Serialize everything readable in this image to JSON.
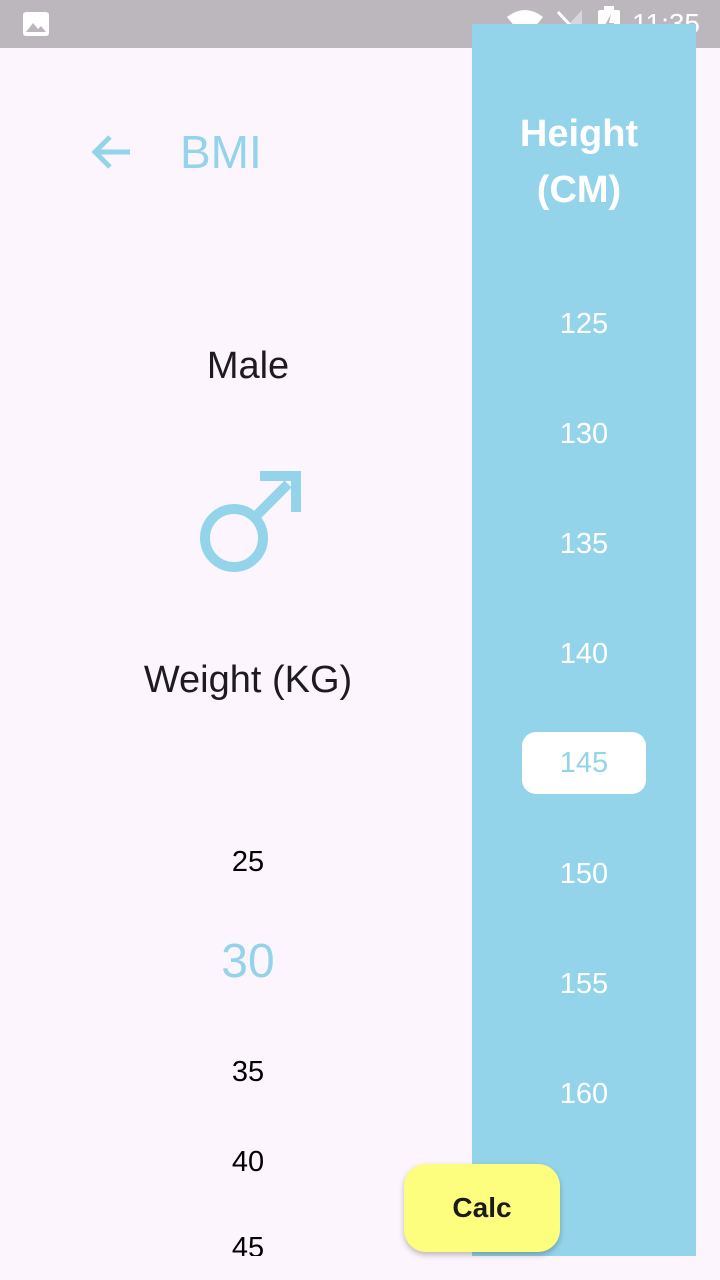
{
  "status_bar": {
    "time": "11:35",
    "icons": [
      "gallery-icon",
      "wifi-icon",
      "no-signal-icon",
      "battery-charging-icon"
    ]
  },
  "header": {
    "back_icon": "arrow-left-icon",
    "title": "BMI"
  },
  "gender": {
    "label": "Male",
    "icon": "male-symbol-icon"
  },
  "weight": {
    "label": "Weight (KG)",
    "options": [
      "25",
      "30",
      "35",
      "40",
      "45"
    ],
    "selected": "30"
  },
  "height": {
    "title_line1": "Height",
    "title_line2": "(CM)",
    "options": [
      "125",
      "130",
      "135",
      "140",
      "145",
      "150",
      "155",
      "160"
    ],
    "selected": "145"
  },
  "calc_button": {
    "label": "Calc"
  },
  "colors": {
    "accent": "#94d4ea",
    "background": "#fcf5fd",
    "calc_button": "#fefe7e",
    "status_bar": "#bbb7bc"
  }
}
